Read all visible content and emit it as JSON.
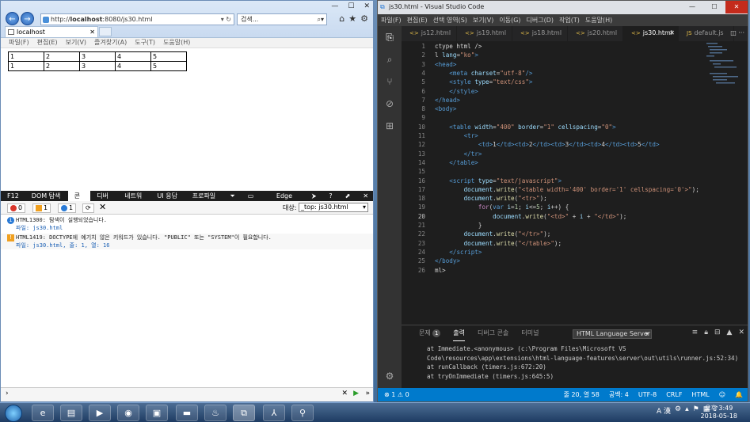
{
  "ie": {
    "url_prefix": "http://",
    "url_host": "localhost",
    "url_rest": ":8080/js30.html",
    "search_placeholder": "검색...",
    "tab_title": "localhost",
    "menu": [
      "파일(F)",
      "편집(E)",
      "보기(V)",
      "즐겨찾기(A)",
      "도구(T)",
      "도움말(H)"
    ],
    "table_rows": [
      [
        "1",
        "2",
        "3",
        "4",
        "5"
      ],
      [
        "1",
        "2",
        "3",
        "4",
        "5"
      ]
    ],
    "devtools_tabs": [
      "F12",
      "DOM 탐색기",
      "콘솔",
      "디버거",
      "네트워크",
      "UI 응답성",
      "프로파일러"
    ],
    "devtools_selected": "콘솔",
    "edge_label": "Edge",
    "errors": "0",
    "warnings": "1",
    "infos": "1",
    "target_label": "대상:",
    "target_value": "_top: js30.html",
    "messages": [
      {
        "type": "info",
        "text": "HTML1300: 탐색이 실행되었습니다.",
        "file": "파일: js30.html"
      },
      {
        "type": "warn",
        "text": "HTML1419: DOCTYPE에 예기치 않은 키워드가 있습니다. \"PUBLIC\" 또는 \"SYSTEM\"이 필요합니다.",
        "file": "파일: js30.html, 줄: 1, 열: 16"
      }
    ]
  },
  "vs": {
    "title": "js30.html - Visual Studio Code",
    "menu": [
      "파일(F)",
      "편집(E)",
      "선택 영역(S)",
      "보기(V)",
      "이동(G)",
      "디버그(D)",
      "작업(T)",
      "도움말(H)"
    ],
    "tabs": [
      {
        "label": "js12.html",
        "icon": "<>"
      },
      {
        "label": "js19.html",
        "icon": "<>"
      },
      {
        "label": "js18.html",
        "icon": "<>"
      },
      {
        "label": "js20.html",
        "icon": "<>"
      },
      {
        "label": "js30.html",
        "icon": "<>",
        "active": true
      },
      {
        "label": "default.js",
        "icon": "JS"
      }
    ],
    "panel_tabs": [
      "문제",
      "출력",
      "디버그 콘솔",
      "터미널"
    ],
    "problems_count": "1",
    "panel_active": "출력",
    "output_channel": "HTML Language Server",
    "output_lines": [
      "at Immediate.<anonymous> (c:\\Program Files\\Microsoft VS",
      "Code\\resources\\app\\extensions\\html-language-features\\server\\out\\utils\\runner.js:52:34)",
      "at runCallback (timers.js:672:20)",
      "at tryOnImmediate (timers.js:645:5)"
    ],
    "status_left": "⊗ 1  ⚠ 0",
    "status_right": [
      "줄 20, 열 58",
      "공백: 4",
      "UTF-8",
      "CRLF",
      "HTML",
      "☺",
      "🔔"
    ]
  },
  "taskbar": {
    "clock_time": "오후 3:49",
    "clock_date": "2018-05-18",
    "ime": "A 漢"
  }
}
